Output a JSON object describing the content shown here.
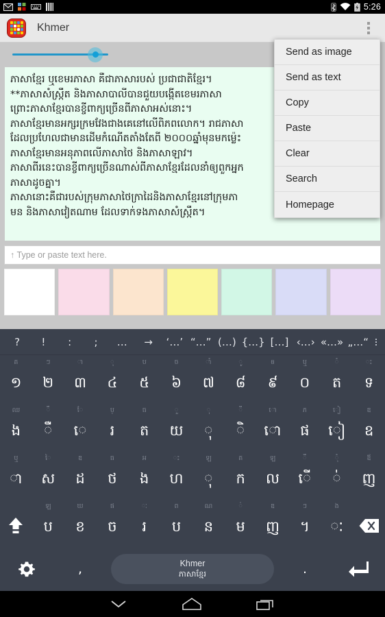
{
  "statusbar": {
    "icons": [
      "gmail-icon",
      "app-squares-icon",
      "keyboard-icon",
      "bars-icon"
    ],
    "bluetooth": "bluetooth-icon",
    "wifi": "wifi-icon",
    "battery": "battery-icon",
    "clock": "5:26"
  },
  "actionbar": {
    "title": "Khmer",
    "icon": "app-icon",
    "overflow": "overflow-menu-icon"
  },
  "slider": {
    "value_position": 121,
    "track_color": "#2196c9",
    "thumb_color": "#13a0d8"
  },
  "textpanel": {
    "background": "#e9fdf1",
    "lines": [
      "ភាសាខ្មែរ ឬខេមរភាសា គឺជាភាសារបស់ ប្រជាជាតិខ្មែរ។",
      "**ភាសាសំស្ក្រឹត និងភាសាបាលីបានជួយបង្កើតខេមរភាសា",
      "ព្រោះភាសាខ្មែរបានខ្ចីពាក្យច្រើនពីភាសាអស់នោះ។",
      "ភាសាខ្មែរមានអក្សរក្រមវែងជាងគេនៅលើពិភពលោក។ រាជភាសា",
      "ដែលប្រហែលជាមានដើមកំណើតតាំងតែពី ២០០០ឆ្នាំមុនមកម្ល៉េះ",
      "ភាសាខ្មែរមានអនុភាពលើភាសាថៃ និងភាសាឡាវ។",
      "ភាសាពីរនេះបានខ្ចីពាក្យច្រើនណាស់ពីភាសាខ្មែរដែលនាំឲ្យពួកអ្នក",
      "ភាសាដូចគ្នា។",
      "ភាសានោះគឺជារបស់ក្រុមភាសាថៃក្រាដៃនិងភាសាខ្មែរនៅក្រុមភា",
      "មន និងភាសាវៀតណាម ដែលទាក់ទងភាសាសំស្ក្រឹត។"
    ]
  },
  "input": {
    "placeholder": "↑ Type or paste text here."
  },
  "swatches": [
    {
      "name": "swatch-white",
      "color": "#ffffff"
    },
    {
      "name": "swatch-pink",
      "color": "#fadce9"
    },
    {
      "name": "swatch-peach",
      "color": "#fce5ce"
    },
    {
      "name": "swatch-yellow",
      "color": "#fbf79a"
    },
    {
      "name": "swatch-mint",
      "color": "#d2f7e6"
    },
    {
      "name": "swatch-blue",
      "color": "#d9dcf7"
    },
    {
      "name": "swatch-purple",
      "color": "#ecdcf7"
    }
  ],
  "menu": {
    "items": [
      "Send as image",
      "Send as text",
      "Copy",
      "Paste",
      "Clear",
      "Search",
      "Homepage"
    ]
  },
  "keyboard": {
    "symbol_row": [
      "?",
      "!",
      ":",
      ";",
      "…",
      "→",
      "‘…’",
      "“…”",
      "(…)",
      "{…}",
      "[…]",
      "‹…›",
      "«…»",
      "„…“"
    ],
    "rows": [
      {
        "keys": [
          {
            "hint": "គ",
            "main": "១"
          },
          {
            "hint": "ៗ",
            "main": "២"
          },
          {
            "hint": "ា",
            "main": "៣"
          },
          {
            "hint": "ុ",
            "main": "៤"
          },
          {
            "hint": "ប",
            "main": "៥"
          },
          {
            "hint": "ច",
            "main": "៦"
          },
          {
            "hint": "ាំ",
            "main": "៧"
          },
          {
            "hint": "ូ",
            "main": "៨"
          },
          {
            "hint": "ឲ",
            "main": "៩"
          },
          {
            "hint": "ឬ",
            "main": "០"
          },
          {
            "hint": "ំ",
            "main": "ត"
          },
          {
            "hint": "ះ",
            "main": "ទ"
          }
        ]
      },
      {
        "keys": [
          {
            "hint": "ឈ",
            "main": "ង"
          },
          {
            "hint": "ឹ",
            "main": "ឺ"
          },
          {
            "hint": "ែ",
            "main": "េ"
          },
          {
            "hint": "ប្",
            "main": "រ"
          },
          {
            "hint": "ធ",
            "main": "ត"
          },
          {
            "hint": "ួ",
            "main": "យ"
          },
          {
            "hint": "ុ",
            "main": "ុ"
          },
          {
            "hint": "ី",
            "main": "ិ"
          },
          {
            "hint": "ោ",
            "main": "ោ"
          },
          {
            "hint": "ភ",
            "main": "ផ"
          },
          {
            "hint": "ៀ",
            "main": "ៀ"
          },
          {
            "hint": "ឌ",
            "main": "ឧ"
          }
        ]
      },
      {
        "keys": [
          {
            "hint": "ឬ",
            "main": "ា"
          },
          {
            "hint": "ៃ",
            "main": "ស"
          },
          {
            "hint": "ឌ",
            "main": "ដ"
          },
          {
            "hint": "ធ",
            "main": "ថ"
          },
          {
            "hint": "អ",
            "main": "ង"
          },
          {
            "hint": "ះ",
            "main": "ហ"
          },
          {
            "hint": "ឡ",
            "main": "ុ"
          },
          {
            "hint": "គ",
            "main": "ក"
          },
          {
            "hint": "ឡ",
            "main": "ល"
          },
          {
            "hint": "ឺ",
            "main": "ើ"
          },
          {
            "hint": "ុំ",
            "main": "់"
          },
          {
            "hint": "ឪ",
            "main": "ញ"
          }
        ]
      },
      {
        "keys": [
          {
            "hint": "",
            "main": "shift-icon",
            "special": "shift"
          },
          {
            "hint": "ឡ",
            "main": "ប"
          },
          {
            "hint": "ឃ",
            "main": "ខ"
          },
          {
            "hint": "ផ",
            "main": "ច"
          },
          {
            "hint": "ៈ",
            "main": "រ"
          },
          {
            "hint": "ព",
            "main": "ប"
          },
          {
            "hint": "ណ",
            "main": "ន"
          },
          {
            "hint": "់",
            "main": "ម"
          },
          {
            "hint": "ឌ",
            "main": "ញ"
          },
          {
            "hint": "ៗ",
            "main": "។"
          },
          {
            "hint": "ង",
            "main": "ៈ"
          },
          {
            "hint": "",
            "main": "backspace-icon",
            "special": "backspace"
          }
        ]
      }
    ],
    "bottom": {
      "settings": "gear-icon",
      "comma": ",",
      "space_label_1": "Khmer",
      "space_label_2": "ភាសាខ្មែរ",
      "period": ".",
      "enter": "enter-icon"
    }
  },
  "navbar": {
    "back": "hide-keyboard-chevron-icon",
    "home": "home-icon",
    "recents": "recents-icon"
  }
}
